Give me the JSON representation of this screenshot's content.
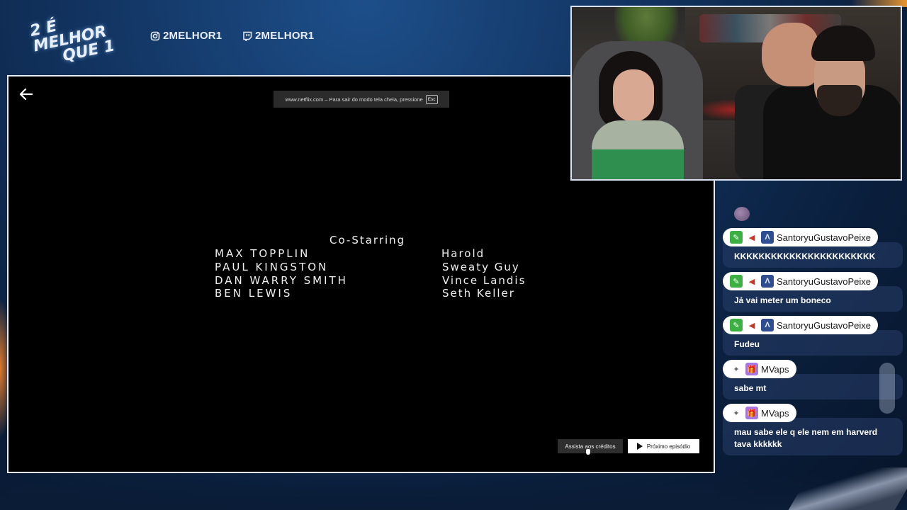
{
  "header": {
    "logo_line1": "2 É MELHOR",
    "logo_line2": "QUE 1",
    "instagram": "2MELHOR1",
    "twitch": "2MELHOR1"
  },
  "player": {
    "fullscreen_notice": "www.netflix.com – Para sair do modo tela cheia, pressione",
    "fullscreen_key": "Esc",
    "credits_section": "Co-Starring",
    "credits": [
      {
        "actor": "MAX TOPPLIN",
        "role": "Harold"
      },
      {
        "actor": "PAUL KINGSTON",
        "role": "Sweaty Guy"
      },
      {
        "actor": "DAN WARRY SMITH",
        "role": "Vince Landis"
      },
      {
        "actor": "BEN LEWIS",
        "role": "Seth Keller"
      }
    ],
    "watch_credits_label": "Assista aos créditos",
    "next_episode_label": "Próximo episódio"
  },
  "chat": {
    "messages": [
      {
        "user": "SantoryuGustavoPeixe",
        "text": "KKKKKKKKKKKKKKKKKKKKKKK",
        "badges": [
          "pencil-badge",
          "hat-badge",
          "arch-badge"
        ]
      },
      {
        "user": "SantoryuGustavoPeixe",
        "text": "Já vai meter um boneco",
        "badges": [
          "pencil-badge",
          "hat-badge",
          "arch-badge"
        ]
      },
      {
        "user": "SantoryuGustavoPeixe",
        "text": "Fudeu",
        "badges": [
          "pencil-badge",
          "hat-badge",
          "arch-badge"
        ]
      },
      {
        "user": "MVaps",
        "text": "sabe mt",
        "badges": [
          "mvp-badge",
          "gift-badge"
        ]
      },
      {
        "user": "MVaps",
        "text": "mau sabe ele q ele nem em harverd tava kkkkkk",
        "badges": [
          "mvp-badge",
          "gift-badge"
        ]
      }
    ]
  },
  "colors": {
    "background": "#123461",
    "chat_bubble": "#283e69",
    "video_border": "#e8edf5",
    "next_button": "#ffffff"
  }
}
